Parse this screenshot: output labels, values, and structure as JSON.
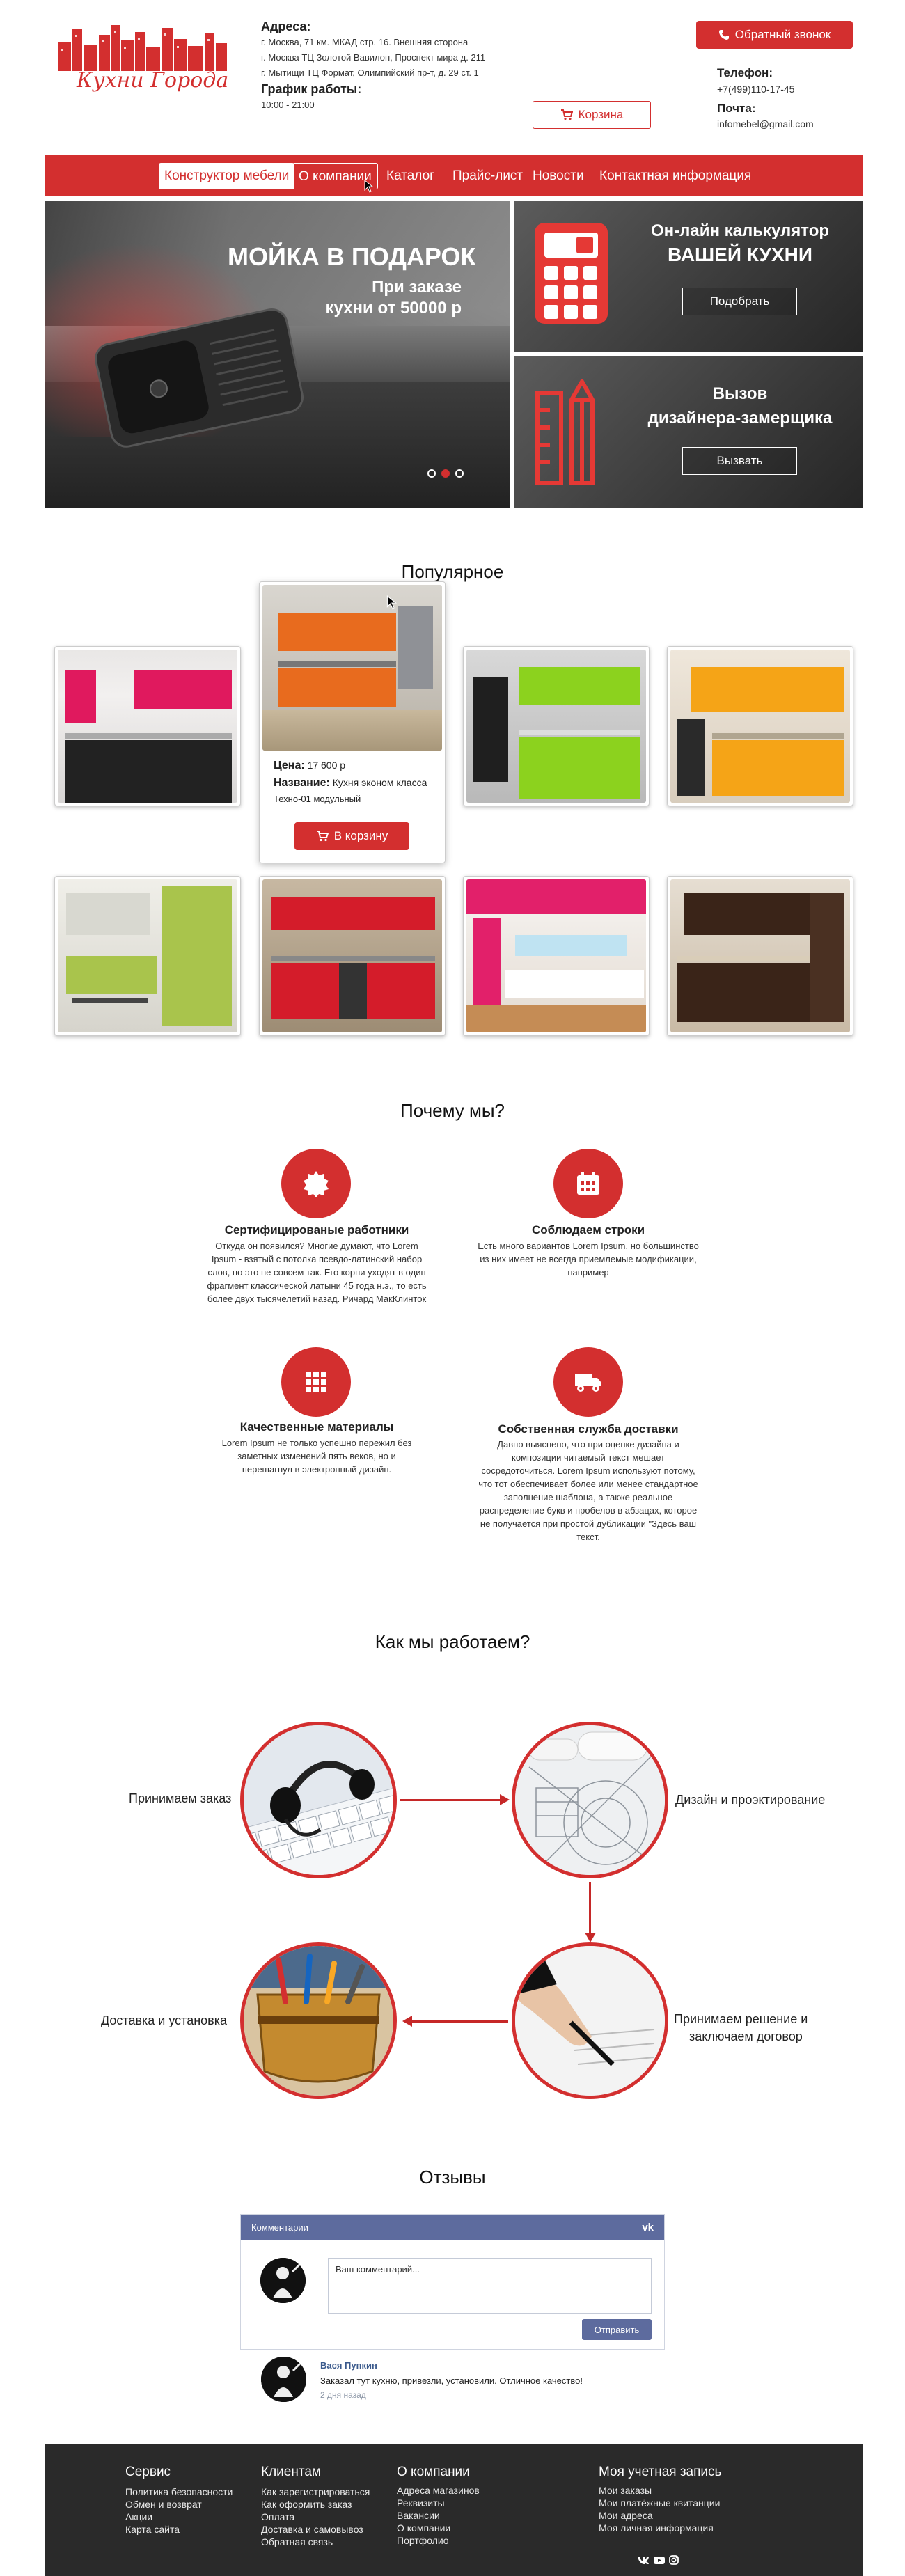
{
  "header": {
    "logo_text": "Кухни Города",
    "address_title": "Адреса:",
    "addresses": [
      "г. Москва, 71 км. МКАД стр. 16. Внешняя сторона",
      "г. Москва ТЦ Золотой Вавилон, Проспект мира д. 211",
      "г. Мытищи ТЦ Формат, Олимпийский пр-т, д. 29 ст. 1"
    ],
    "schedule_title": "График работы:",
    "schedule": "10:00 - 21:00",
    "callback_label": "Обратный звонок",
    "phone_title": "Телефон:",
    "phone": "+7(499)110-17-45",
    "mail_title": "Почта:",
    "email": "infomebel@gmail.com",
    "cart_label": "Корзина"
  },
  "nav": {
    "items": [
      "Конструктор мебели",
      "О компании",
      "Каталог",
      "Прайс-лист",
      "Новости",
      "Контактная информация"
    ]
  },
  "hero": {
    "main_title": "МОЙКА В ПОДАРОК",
    "main_sub1": "При заказе",
    "main_sub2": "кухни от 50000 р",
    "calc_line1": "Он-лайн калькулятор",
    "calc_line2": "ВАШЕЙ КУХНИ",
    "calc_button": "Подобрать",
    "designer_line1": "Вызов",
    "designer_line2": "дизайнера-замерщика",
    "designer_button": "Вызвать"
  },
  "popular": {
    "title": "Популярное",
    "card": {
      "price_label": "Цена:",
      "price_value": "17 600 р",
      "name_label": "Название:",
      "name_value": "Кухня эконом класса",
      "name_value2": "Техно-01 модульный",
      "cart_button": "В корзину"
    }
  },
  "why": {
    "title": "Почему мы?",
    "items": [
      {
        "title": "Сертифицированые работники",
        "text": "Откуда он появился? Многие думают, что Lorem Ipsum - взятый с потолка псевдо-латинский набор слов, но это не совсем так. Его корни уходят в один фрагмент классической латыни 45 года н.э., то есть более двух тысячелетий назад. Ричард МакКлинток"
      },
      {
        "title": "Соблюдаем строки",
        "text": "Есть много вариантов Lorem Ipsum, но большинство из них имеет не всегда приемлемые модификации, например"
      },
      {
        "title": "Качественные материалы",
        "text": "Lorem Ipsum не только успешно пережил без заметных изменений пять веков, но и перешагнул в электронный дизайн."
      },
      {
        "title": "Собственная служба доставки",
        "text": "Давно выяснено, что при оценке дизайна и композиции читаемый текст мешает сосредоточиться. Lorem Ipsum используют потому, что тот обеспечивает более или менее стандартное заполнение шаблона, а также реальное распределение букв и пробелов в абзацах, которое не получается при простой дубликации \"Здесь ваш текст."
      }
    ]
  },
  "how": {
    "title": "Как мы работаем?",
    "steps": [
      "Принимаем заказ",
      "Дизайн и проэктирование",
      "Принимаем решение и",
      "заключаем договор",
      "Доставка и установка"
    ]
  },
  "reviews": {
    "title": "Отзывы",
    "widget_title": "Комментарии",
    "widget_logo": "vk",
    "placeholder": "Ваш комментарий...",
    "send_label": "Отправить",
    "author": "Вася Пупкин",
    "comment": "Заказал тут кухню, привезли, установили. Отличное качество!",
    "time": "2 дня назад"
  },
  "footer": {
    "columns": [
      {
        "title": "Сервис",
        "links": [
          "Политика безопасности",
          "Обмен и возврат",
          "Акции",
          "Карта сайта"
        ]
      },
      {
        "title": "Клиентам",
        "links": [
          "Как зарегистрироваться",
          "Как оформить заказ",
          "Оплата",
          "Доставка и самовывоз",
          "Обратная связь"
        ]
      },
      {
        "title": "О компании",
        "links": [
          "Адреса магазинов",
          "Реквизиты",
          "Вакансии",
          "О компании",
          "Портфолио"
        ]
      },
      {
        "title": "Моя учетная запись",
        "links": [
          "Мои заказы",
          "Мои платёжные квитанции",
          "Мои адреса",
          "Моя личная информация"
        ]
      }
    ],
    "social_icons": [
      "vk-icon",
      "youtube-icon",
      "instagram-icon"
    ]
  },
  "colors": {
    "accent": "#d32f2f",
    "vk": "#5d6b9e",
    "footer": "#2a2a2a"
  }
}
